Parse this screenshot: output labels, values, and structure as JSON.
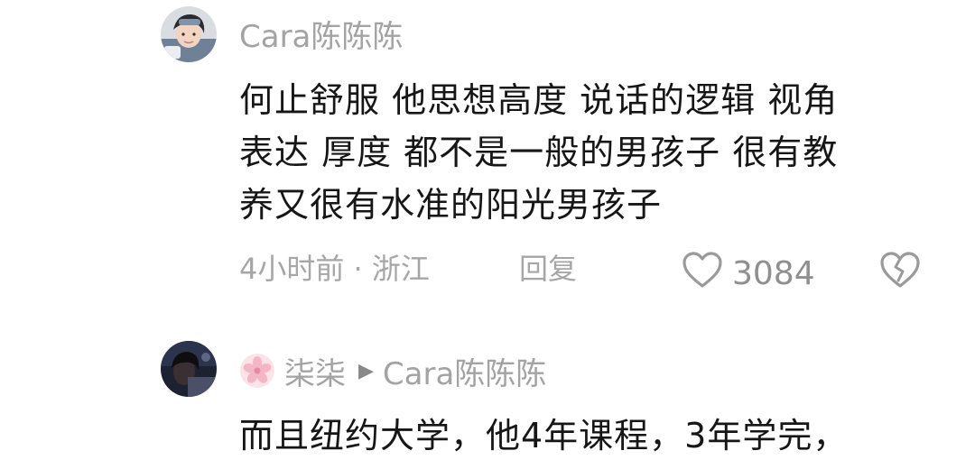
{
  "comments": [
    {
      "username": "Cara陈陈陈",
      "lines": [
        "何止舒服 他思想高度 说话的逻辑 视角",
        "表达 厚度 都不是一般的男孩子 很有教",
        "养又很有水准的阳光男孩子"
      ],
      "time_location": "4小时前 · 浙江",
      "reply_label": "回复",
      "like_count": "3084",
      "avatar_icon": "user-avatar-photo"
    },
    {
      "username": "柒柒",
      "reply_to": "Cara陈陈陈",
      "lines": [
        "而且纽约大学，他4年课程，3年学完，"
      ],
      "avatar_icon": "user-avatar-photo",
      "badge_icon": "sakura-flower-icon"
    }
  ],
  "colors": {
    "username": "#a3a3a3",
    "text": "#161616",
    "meta": "#a6a6a6",
    "background": "#ffffff"
  }
}
